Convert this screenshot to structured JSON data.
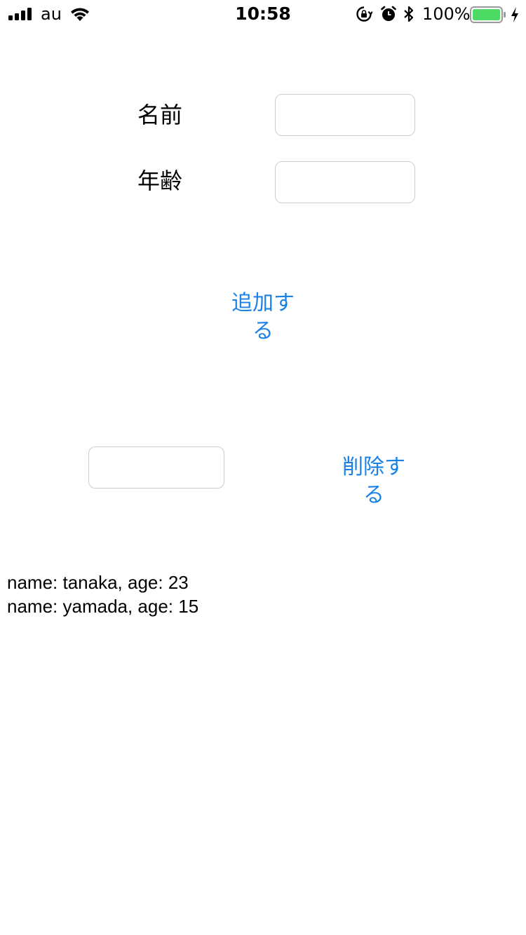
{
  "status_bar": {
    "carrier": "au",
    "time": "10:58",
    "battery_percent": "100%",
    "battery_level": 1.0,
    "signal_bars": 4,
    "icons": [
      "signal-icon",
      "wifi-icon",
      "rotation-lock-icon",
      "alarm-icon",
      "bluetooth-icon",
      "battery-icon",
      "charging-icon"
    ]
  },
  "form": {
    "name_label": "名前",
    "name_value": "",
    "age_label": "年齢",
    "age_value": "",
    "add_button": "追加する"
  },
  "delete_section": {
    "input_value": "",
    "delete_button": "削除する"
  },
  "records": [
    "name: tanaka, age: 23",
    "name: yamada, age: 15"
  ],
  "colors": {
    "accent": "#1a82e6",
    "battery_fill": "#4cd964",
    "field_border": "#cdcdcd"
  }
}
